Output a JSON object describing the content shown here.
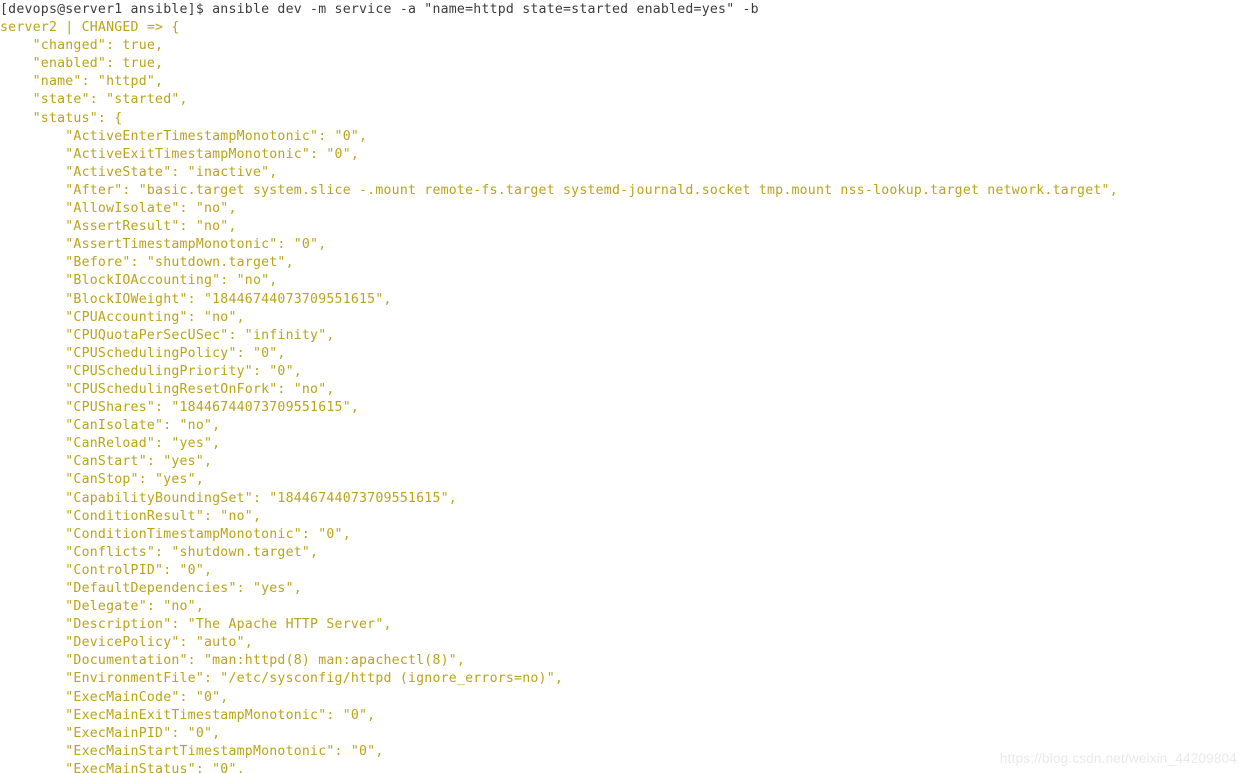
{
  "terminal": {
    "window_title": "devops@server1:~/ansible",
    "background_color": "#ffffff",
    "prompt_color": "#3c3c3c",
    "output_color": "#b9a41a",
    "prompt_line": {
      "user": "devops",
      "host": "server1",
      "cwd": "ansible",
      "symbol": "$",
      "full_prompt": "[devops@server1 ansible]$",
      "command": "ansible dev -m service -a \"name=httpd state=started enabled=yes\" -b",
      "text": "[devops@server1 ansible]$ ansible dev -m service -a \"name=httpd state=started enabled=yes\" -b"
    },
    "result_header": "server2 | CHANGED => {",
    "output_lines": [
      "server2 | CHANGED => {",
      "    \"changed\": true,",
      "    \"enabled\": true,",
      "    \"name\": \"httpd\",",
      "    \"state\": \"started\",",
      "    \"status\": {",
      "        \"ActiveEnterTimestampMonotonic\": \"0\",",
      "        \"ActiveExitTimestampMonotonic\": \"0\",",
      "        \"ActiveState\": \"inactive\",",
      "        \"After\": \"basic.target system.slice -.mount remote-fs.target systemd-journald.socket tmp.mount nss-lookup.target network.target\",",
      "        \"AllowIsolate\": \"no\",",
      "        \"AssertResult\": \"no\",",
      "        \"AssertTimestampMonotonic\": \"0\",",
      "        \"Before\": \"shutdown.target\",",
      "        \"BlockIOAccounting\": \"no\",",
      "        \"BlockIOWeight\": \"18446744073709551615\",",
      "        \"CPUAccounting\": \"no\",",
      "        \"CPUQuotaPerSecUSec\": \"infinity\",",
      "        \"CPUSchedulingPolicy\": \"0\",",
      "        \"CPUSchedulingPriority\": \"0\",",
      "        \"CPUSchedulingResetOnFork\": \"no\",",
      "        \"CPUShares\": \"18446744073709551615\",",
      "        \"CanIsolate\": \"no\",",
      "        \"CanReload\": \"yes\",",
      "        \"CanStart\": \"yes\",",
      "        \"CanStop\": \"yes\",",
      "        \"CapabilityBoundingSet\": \"18446744073709551615\",",
      "        \"ConditionResult\": \"no\",",
      "        \"ConditionTimestampMonotonic\": \"0\",",
      "        \"Conflicts\": \"shutdown.target\",",
      "        \"ControlPID\": \"0\",",
      "        \"DefaultDependencies\": \"yes\",",
      "        \"Delegate\": \"no\",",
      "        \"Description\": \"The Apache HTTP Server\",",
      "        \"DevicePolicy\": \"auto\",",
      "        \"Documentation\": \"man:httpd(8) man:apachectl(8)\",",
      "        \"EnvironmentFile\": \"/etc/sysconfig/httpd (ignore_errors=no)\",",
      "        \"ExecMainCode\": \"0\",",
      "        \"ExecMainExitTimestampMonotonic\": \"0\",",
      "        \"ExecMainPID\": \"0\",",
      "        \"ExecMainStartTimestampMonotonic\": \"0\",",
      "        \"ExecMainStatus\": \"0\","
    ],
    "result_fields": {
      "changed": "true",
      "enabled": "true",
      "name": "httpd",
      "state": "started"
    },
    "status_fields": [
      {
        "key": "ActiveEnterTimestampMonotonic",
        "value": "0"
      },
      {
        "key": "ActiveExitTimestampMonotonic",
        "value": "0"
      },
      {
        "key": "ActiveState",
        "value": "inactive"
      },
      {
        "key": "After",
        "value": "basic.target system.slice -.mount remote-fs.target systemd-journald.socket tmp.mount nss-lookup.target network.target"
      },
      {
        "key": "AllowIsolate",
        "value": "no"
      },
      {
        "key": "AssertResult",
        "value": "no"
      },
      {
        "key": "AssertTimestampMonotonic",
        "value": "0"
      },
      {
        "key": "Before",
        "value": "shutdown.target"
      },
      {
        "key": "BlockIOAccounting",
        "value": "no"
      },
      {
        "key": "BlockIOWeight",
        "value": "18446744073709551615"
      },
      {
        "key": "CPUAccounting",
        "value": "no"
      },
      {
        "key": "CPUQuotaPerSecUSec",
        "value": "infinity"
      },
      {
        "key": "CPUSchedulingPolicy",
        "value": "0"
      },
      {
        "key": "CPUSchedulingPriority",
        "value": "0"
      },
      {
        "key": "CPUSchedulingResetOnFork",
        "value": "no"
      },
      {
        "key": "CPUShares",
        "value": "18446744073709551615"
      },
      {
        "key": "CanIsolate",
        "value": "no"
      },
      {
        "key": "CanReload",
        "value": "yes"
      },
      {
        "key": "CanStart",
        "value": "yes"
      },
      {
        "key": "CanStop",
        "value": "yes"
      },
      {
        "key": "CapabilityBoundingSet",
        "value": "18446744073709551615"
      },
      {
        "key": "ConditionResult",
        "value": "no"
      },
      {
        "key": "ConditionTimestampMonotonic",
        "value": "0"
      },
      {
        "key": "Conflicts",
        "value": "shutdown.target"
      },
      {
        "key": "ControlPID",
        "value": "0"
      },
      {
        "key": "DefaultDependencies",
        "value": "yes"
      },
      {
        "key": "Delegate",
        "value": "no"
      },
      {
        "key": "Description",
        "value": "The Apache HTTP Server"
      },
      {
        "key": "DevicePolicy",
        "value": "auto"
      },
      {
        "key": "Documentation",
        "value": "man:httpd(8) man:apachectl(8)"
      },
      {
        "key": "EnvironmentFile",
        "value": "/etc/sysconfig/httpd (ignore_errors=no)"
      },
      {
        "key": "ExecMainCode",
        "value": "0"
      },
      {
        "key": "ExecMainExitTimestampMonotonic",
        "value": "0"
      },
      {
        "key": "ExecMainPID",
        "value": "0"
      },
      {
        "key": "ExecMainStartTimestampMonotonic",
        "value": "0"
      },
      {
        "key": "ExecMainStatus",
        "value": "0"
      }
    ]
  },
  "watermark": {
    "text": "https://blog.csdn.net/weixin_44209804"
  }
}
